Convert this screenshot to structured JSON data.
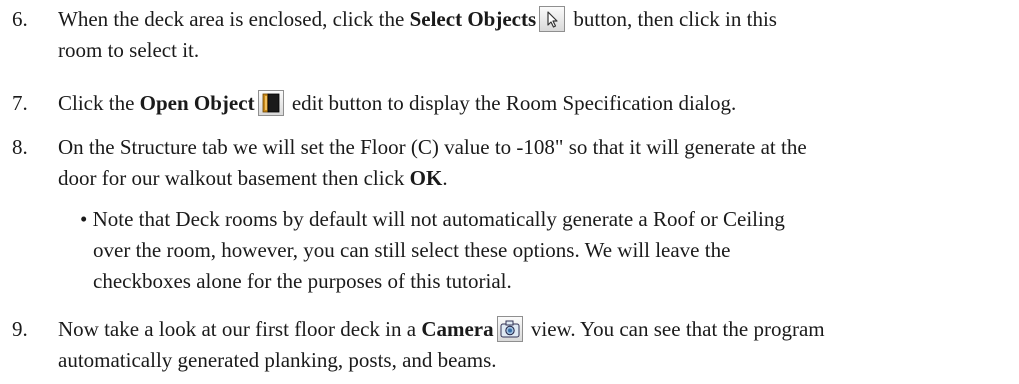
{
  "steps": [
    {
      "number": "6.",
      "line1_before": "When the deck area is enclosed, click the ",
      "line1_bold": "Select Objects",
      "line1_after": " button, then click in this",
      "line2": "room to select it.",
      "icon": "select-objects-icon"
    },
    {
      "number": "7.",
      "line1_before": "Click the ",
      "line1_bold": "Open Object",
      "line1_after": " edit button to display the Room Specification dialog.",
      "icon": "open-object-icon"
    },
    {
      "number": "8.",
      "line1": "On the Structure tab we will set the Floor (C) value to -108\" so that it will generate at the",
      "line2_before": "door for our walkout basement then click ",
      "line2_bold": "OK",
      "line2_after": ".",
      "note": {
        "line1": "• Note that Deck rooms by default will not automatically generate a Roof or Ceiling",
        "line2": "over the room, however, you can still select these options. We will leave the",
        "line3": "checkboxes alone for the purposes of this tutorial."
      }
    },
    {
      "number": "9.",
      "line1_before": "Now take a look at our first floor deck in a ",
      "line1_bold": "Camera",
      "line1_after": " view. You can see that the program",
      "line2": "automatically generated planking, posts, and beams.",
      "icon": "camera-icon"
    }
  ]
}
